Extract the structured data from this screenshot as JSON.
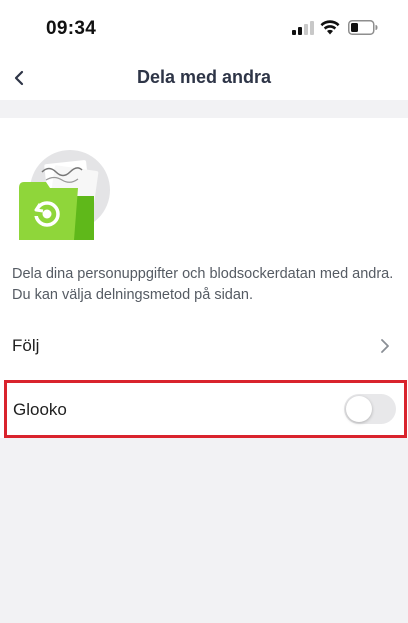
{
  "status_bar": {
    "time": "09:34",
    "icons": [
      "signal-icon",
      "wifi-icon",
      "battery-icon"
    ]
  },
  "nav": {
    "title": "Dela med andra",
    "back_icon": "chevron-left-icon"
  },
  "main": {
    "illustration": "folder-share-illustration",
    "description": "Dela dina personuppgifter och blodsockerdatan med andra. Du kan välja delningsmetod på sidan.",
    "rows": [
      {
        "label": "Följ",
        "accessory": "chevron-right-icon"
      },
      {
        "label": "Glooko",
        "accessory": "toggle",
        "toggle_on": false
      }
    ]
  },
  "colors": {
    "title": "#2e3547",
    "highlight_border": "#d9232d",
    "folder_green": "#7ed321",
    "background": "#f2f2f4"
  }
}
